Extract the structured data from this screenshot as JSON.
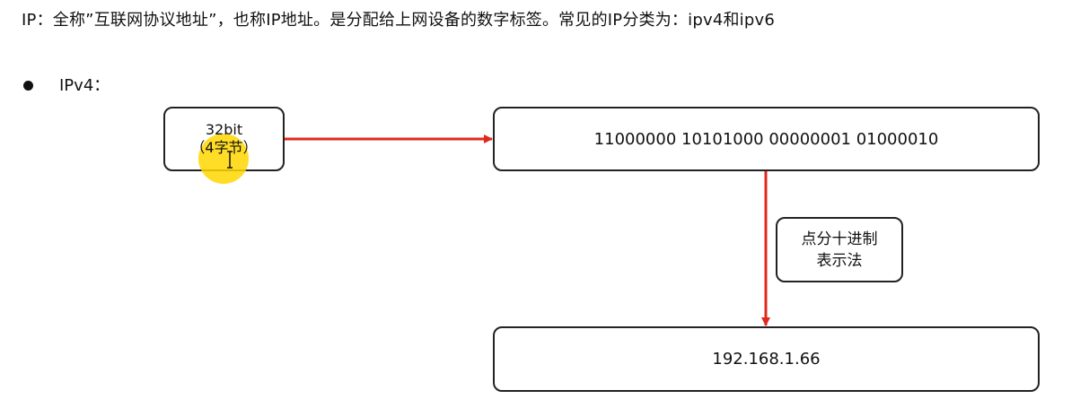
{
  "intro": {
    "text": "IP：全称”互联网协议地址”，也称IP地址。是分配给上网设备的数字标签。常见的IP分类为：ipv4和ipv6"
  },
  "section": {
    "bullet_label": "IPv4："
  },
  "diagram": {
    "size_box": {
      "line1": "32bit",
      "line2": "（4字节）"
    },
    "binary_box": {
      "value": "11000000 10101000 00000001 01000010"
    },
    "method_box": {
      "line1": "点分十进制",
      "line2": "表示法"
    },
    "decimal_box": {
      "value": "192.168.1.66"
    }
  },
  "colors": {
    "arrow": "#e0281e",
    "highlight": "#ffd600",
    "border": "#222222"
  },
  "icons": {
    "cursor": "mouse-cursor-highlight-icon",
    "text_cursor": "i-beam-cursor-icon"
  }
}
